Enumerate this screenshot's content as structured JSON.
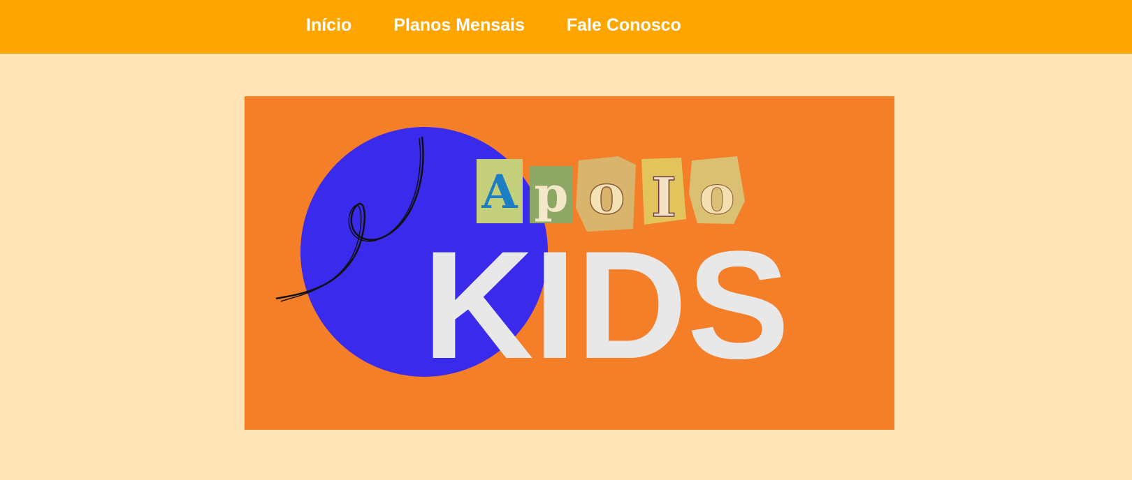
{
  "colors": {
    "header_bg": "#FFA500",
    "page_bg": "#FFE4B5",
    "banner_bg": "#F57E28",
    "circle": "#3A2AEC",
    "kids_text": "#E8E8E8"
  },
  "nav": {
    "items": [
      {
        "label": "Início"
      },
      {
        "label": "Planos Mensais"
      },
      {
        "label": "Fale Conosco"
      }
    ]
  },
  "banner": {
    "logo_letters": [
      "A",
      "p",
      "o",
      "I",
      "o"
    ],
    "kids_word": "KIDS"
  }
}
